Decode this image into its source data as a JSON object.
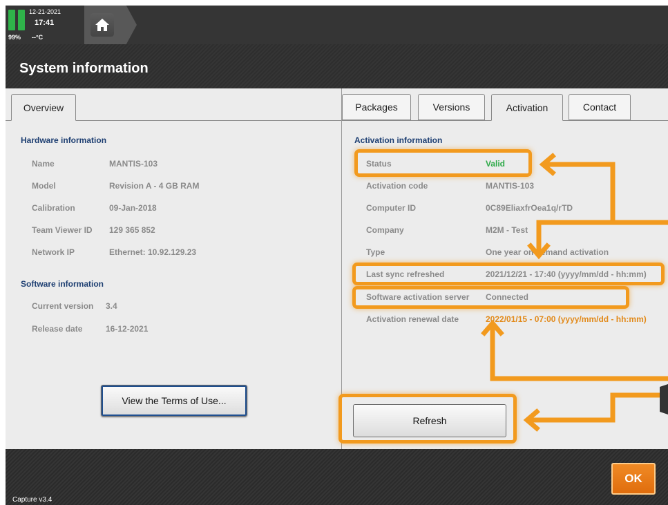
{
  "status_bar": {
    "date": "12-21-2021",
    "time": "17:41",
    "battery_pct": "99%",
    "temperature": "--°C",
    "battery_color": "#2fb34a"
  },
  "header": {
    "title": "System information"
  },
  "left_panel": {
    "tab": "Overview",
    "hardware": {
      "title": "Hardware information",
      "rows": [
        {
          "label": "Name",
          "value": "MANTIS-103"
        },
        {
          "label": "Model",
          "value": "Revision A - 4 GB RAM"
        },
        {
          "label": "Calibration",
          "value": "09-Jan-2018"
        },
        {
          "label": "Team Viewer ID",
          "value": "129 365 852"
        },
        {
          "label": "Network IP",
          "value": "Ethernet: 10.92.129.23"
        }
      ]
    },
    "software": {
      "title": "Software information",
      "rows": [
        {
          "label": "Current version",
          "value": "3.4"
        },
        {
          "label": "Release date",
          "value": "16-12-2021"
        }
      ]
    },
    "terms_button": "View the Terms of Use..."
  },
  "right_panel": {
    "tabs": [
      "Packages",
      "Versions",
      "Activation",
      "Contact"
    ],
    "active_tab": "Activation",
    "activation": {
      "title": "Activation information",
      "rows": [
        {
          "label": "Status",
          "value": "Valid"
        },
        {
          "label": "Activation code",
          "value": "MANTIS-103"
        },
        {
          "label": "Computer ID",
          "value": "0C89EliaxfrOea1q/rTD"
        },
        {
          "label": "Company",
          "value": "M2M - Test"
        },
        {
          "label": "Type",
          "value": "One year on demand activation"
        },
        {
          "label": "Last sync refreshed",
          "value": "2021/12/21 - 17:40 (yyyy/mm/dd - hh:mm)"
        },
        {
          "label": "Software activation server",
          "value": "Connected"
        },
        {
          "label": "Activation renewal date",
          "value": "2022/01/15 - 07:00 (yyyy/mm/dd - hh:mm)"
        }
      ]
    },
    "refresh_button": "Refresh"
  },
  "footer": {
    "version": "Capture v3.4",
    "ok_button": "OK"
  },
  "colors": {
    "accent": "#f29a1e",
    "valid": "#2faa4a",
    "renewal": "#e28a1a",
    "section_title": "#1e3f72"
  }
}
